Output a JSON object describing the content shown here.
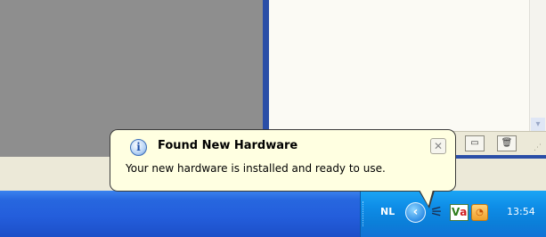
{
  "balloon": {
    "title": "Found New Hardware",
    "message": "Your new hardware is installed and ready to use.",
    "close_glyph": "✕",
    "icon": "info-icon",
    "icon_glyph": "i"
  },
  "taskbar": {
    "language": "NL",
    "clock": "13:54",
    "show_hidden_glyph": "‹",
    "tray_icons": [
      "safely-remove-hardware-icon",
      "va-icon",
      "scheduler-icon"
    ],
    "va_letters": [
      "V",
      "a"
    ]
  },
  "window": {
    "statusbar_icons": [
      "layout-icon",
      "trash-icon"
    ],
    "scroll_down_glyph": "▾",
    "grip_glyph": "⋰"
  },
  "colors": {
    "taskbar": "#245edc",
    "tray": "#0e8de7",
    "balloon": "#ffffe1",
    "window_border": "#2a4ea7"
  }
}
